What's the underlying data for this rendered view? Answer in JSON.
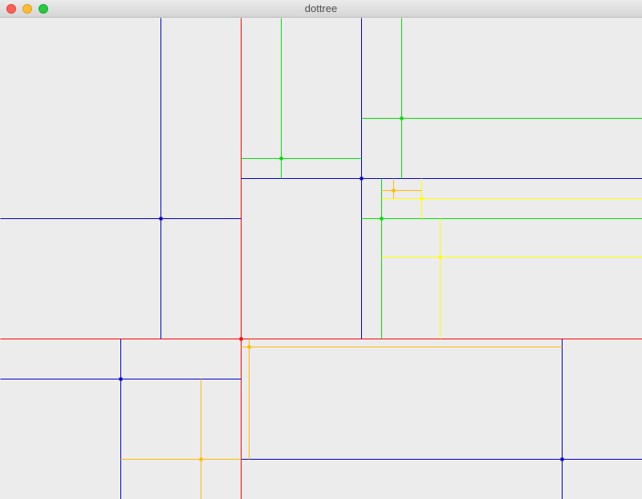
{
  "window": {
    "title": "dottree",
    "controls": {
      "close": "close-button",
      "minimize": "minimize-button",
      "zoom": "zoom-button"
    }
  },
  "palette": {
    "red": "#ff0000",
    "blue": "#0000cc",
    "green": "#00dd00",
    "yellow": "#ffff00",
    "orange": "#ffbb00",
    "background": "#ececec"
  }
}
